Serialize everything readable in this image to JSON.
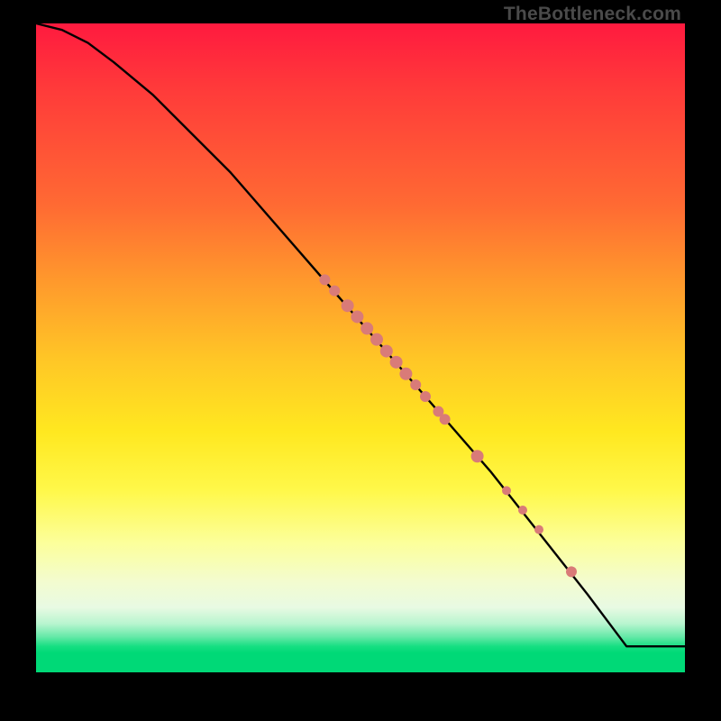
{
  "watermark": "TheBottleneck.com",
  "chart_data": {
    "type": "line",
    "title": "",
    "xlabel": "",
    "ylabel": "",
    "xlim": [
      0,
      100
    ],
    "ylim": [
      0,
      100
    ],
    "grid": false,
    "series": [
      {
        "name": "curve",
        "x": [
          0,
          4,
          8,
          12,
          18,
          30,
          50,
          70,
          85,
          91,
          100
        ],
        "y": [
          100,
          99,
          97,
          94,
          89,
          77,
          54,
          31,
          12,
          4,
          4
        ]
      }
    ],
    "markers": {
      "name": "highlighted-points",
      "color": "#d97b78",
      "points": [
        {
          "x": 44.5,
          "y": 60.5,
          "r": 6
        },
        {
          "x": 46.0,
          "y": 58.8,
          "r": 6
        },
        {
          "x": 48.0,
          "y": 56.5,
          "r": 7
        },
        {
          "x": 49.5,
          "y": 54.8,
          "r": 7
        },
        {
          "x": 51.0,
          "y": 53.0,
          "r": 7
        },
        {
          "x": 52.5,
          "y": 51.3,
          "r": 7
        },
        {
          "x": 54.0,
          "y": 49.5,
          "r": 7
        },
        {
          "x": 55.5,
          "y": 47.8,
          "r": 7
        },
        {
          "x": 57.0,
          "y": 46.0,
          "r": 7
        },
        {
          "x": 58.5,
          "y": 44.3,
          "r": 6
        },
        {
          "x": 60.0,
          "y": 42.5,
          "r": 6
        },
        {
          "x": 62.0,
          "y": 40.2,
          "r": 6
        },
        {
          "x": 63.0,
          "y": 39.0,
          "r": 6
        },
        {
          "x": 68.0,
          "y": 33.3,
          "r": 7
        },
        {
          "x": 72.5,
          "y": 28.0,
          "r": 5
        },
        {
          "x": 75.0,
          "y": 25.0,
          "r": 5
        },
        {
          "x": 77.5,
          "y": 22.0,
          "r": 5
        },
        {
          "x": 82.5,
          "y": 15.5,
          "r": 6
        }
      ]
    }
  }
}
